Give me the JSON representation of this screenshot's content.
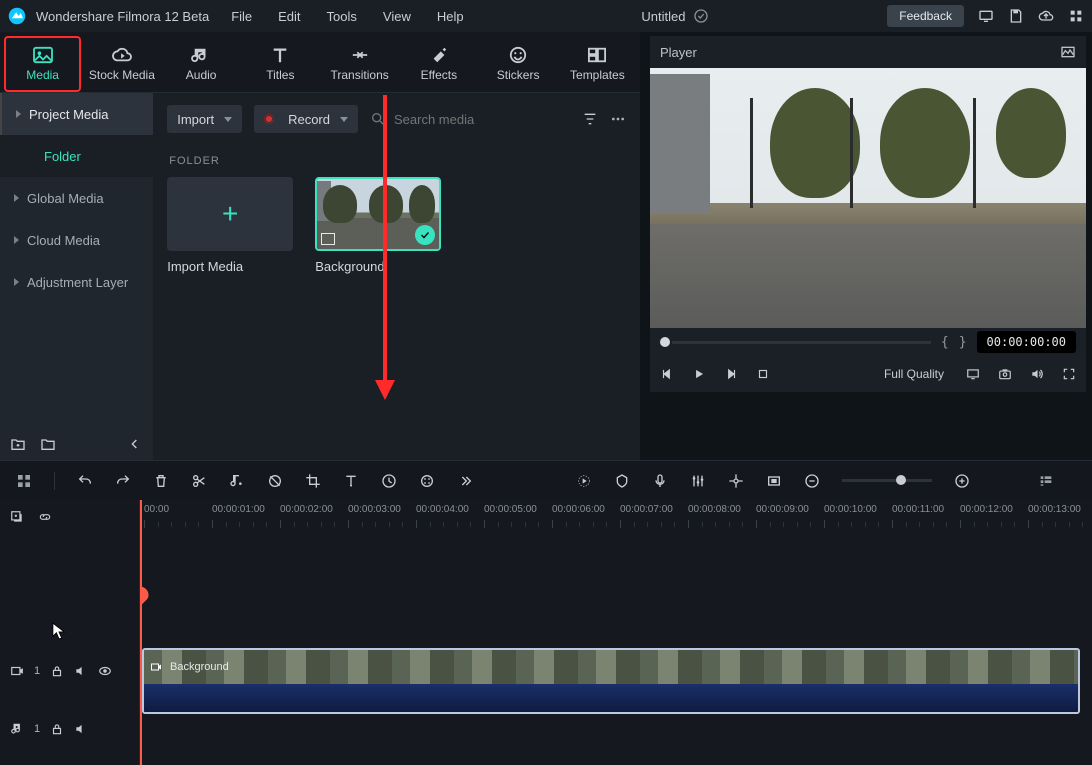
{
  "titlebar": {
    "app_name": "Wondershare Filmora 12 Beta",
    "menus": [
      "File",
      "Edit",
      "Tools",
      "View",
      "Help"
    ],
    "doc_title": "Untitled",
    "feedback": "Feedback"
  },
  "tabs": [
    "Media",
    "Stock Media",
    "Audio",
    "Titles",
    "Transitions",
    "Effects",
    "Stickers",
    "Templates"
  ],
  "sidebar": {
    "items": [
      "Project Media",
      "Folder",
      "Global Media",
      "Cloud Media",
      "Adjustment Layer"
    ]
  },
  "media_toolbar": {
    "import_label": "Import",
    "record_label": "Record",
    "search_placeholder": "Search media"
  },
  "folder_heading": "FOLDER",
  "cards": {
    "import_label": "Import Media",
    "bg_label": "Background"
  },
  "player": {
    "title": "Player",
    "timecode": "00:00:00:00",
    "open_brace": "{",
    "close_brace": "}",
    "quality": "Full Quality"
  },
  "timeline": {
    "ticks": [
      "00:00",
      "00:00:01:00",
      "00:00:02:00",
      "00:00:03:00",
      "00:00:04:00",
      "00:00:05:00",
      "00:00:06:00",
      "00:00:07:00",
      "00:00:08:00",
      "00:00:09:00",
      "00:00:10:00",
      "00:00:11:00",
      "00:00:12:00",
      "00:00:13:00"
    ],
    "video_track_num": "1",
    "audio_track_num": "1",
    "clip_name": "Background"
  }
}
